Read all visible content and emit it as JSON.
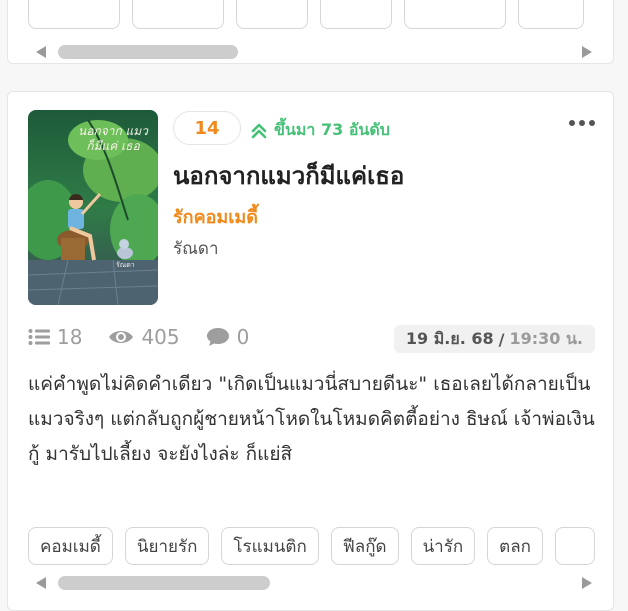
{
  "top_card": {
    "tags": [
      "",
      "",
      "",
      "",
      "",
      ""
    ],
    "scroll_thumb_fraction": 0.3
  },
  "novel": {
    "rank": "14",
    "rank_change": "ขึ้นมา 73 อันดับ",
    "title": "นอกจากแมวก็มีแค่เธอ",
    "category": "รักคอมเมดี้",
    "author": "รัณดา",
    "cover_title": "นอกจาก แมวก็มีแค่ เธอ",
    "cover_author": "รัณดา",
    "chapters": "18",
    "views": "405",
    "comments": "0",
    "date": "19 มิ.ย. 68",
    "date_sep": "/",
    "time": "19:30 น.",
    "description": "แค่คำพูดไม่คิดคำเดียว \"เกิดเป็นแมวนี่สบายดีนะ\" เธอเลยได้กลายเป็นแมวจริงๆ แต่กลับถูกผู้ชายหน้าโหดในโหมดคิตตี้อย่าง ธิษณ์ เจ้าพ่อเงินกู้ มารับไปเลี้ยง จะยังไงล่ะ ก็แย่สิ",
    "tags": [
      "คอมเมดี้",
      "นิยายรัก",
      "โรแมนติก",
      "ฟีลกู๊ด",
      "น่ารัก",
      "ตลก",
      ""
    ],
    "scroll_thumb_fraction": 0.38
  },
  "colors": {
    "accent_orange": "#f18a1c",
    "rank_up_green": "#46c177"
  },
  "icons": {
    "rank_up": "double-chevron-up-icon",
    "more": "more-dots-icon",
    "chapters": "list-icon",
    "views": "eye-icon",
    "comments": "comment-icon"
  }
}
